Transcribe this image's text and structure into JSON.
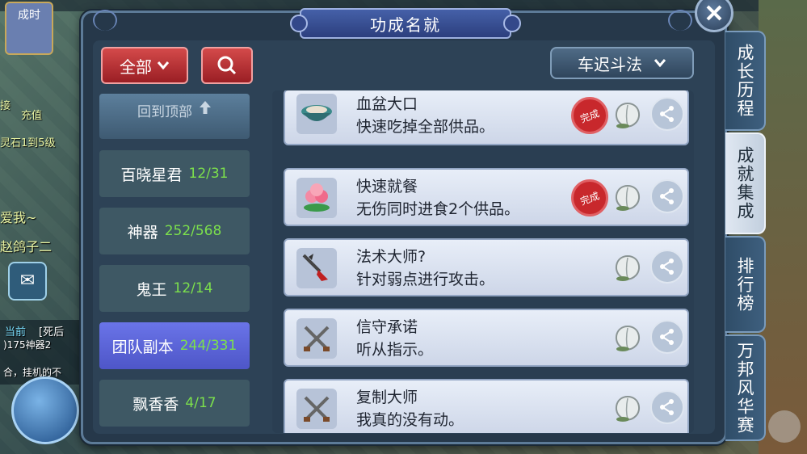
{
  "background": {
    "badge_label": "成时",
    "bg_texts": [
      "接",
      "充值",
      "灵石1到5级",
      "爱我~",
      "赵鸽子二",
      "当前",
      "[死后",
      ")175神器2",
      "合，挂机的不"
    ]
  },
  "panel": {
    "title": "功成名就",
    "filter_label": "全部",
    "mode_label": "车迟斗法"
  },
  "left_list": {
    "back_to_top": "回到顶部",
    "categories": [
      {
        "name": "百晓星君",
        "count": "12/31",
        "active": false
      },
      {
        "name": "神器",
        "count": "252/568",
        "active": false
      },
      {
        "name": "鬼王",
        "count": "12/14",
        "active": false
      },
      {
        "name": "团队副本",
        "count": "244/331",
        "active": true
      },
      {
        "name": "飘香香",
        "count": "4/17",
        "active": false
      }
    ]
  },
  "achievements": [
    {
      "name": "血盆大口",
      "desc": "快速吃掉全部供品。",
      "completed": true,
      "stamp": "完成",
      "icon": "bowl-icon"
    },
    {
      "name": "快速就餐",
      "desc": "无伤同时进食2个供品。",
      "completed": true,
      "stamp": "完成",
      "icon": "peach-icon"
    },
    {
      "name": "法术大师?",
      "desc": "针对弱点进行攻击。",
      "completed": false,
      "icon": "dagger-icon"
    },
    {
      "name": "信守承诺",
      "desc": "听从指示。",
      "completed": false,
      "icon": "crossed-swords-icon"
    },
    {
      "name": "复制大师",
      "desc": "我真的没有动。",
      "completed": false,
      "icon": "crossed-swords-icon"
    }
  ],
  "side_tabs": [
    {
      "label": "成长历程",
      "active": false
    },
    {
      "label": "成就集成",
      "active": true
    },
    {
      "label": "排行榜",
      "active": false
    },
    {
      "label": "万邦风华赛",
      "active": false
    }
  ],
  "colors": {
    "count_green": "#7ce04c",
    "active_category": "#5a62d8",
    "stamp_red": "#c8282c"
  }
}
